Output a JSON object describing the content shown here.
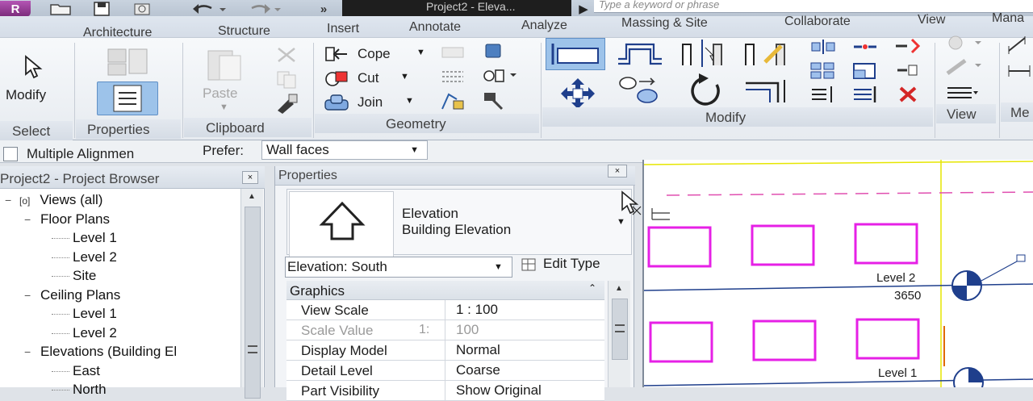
{
  "titlebar": {
    "title": "Project2 - Eleva...",
    "search_placeholder": "Type a keyword or phrase",
    "overflow": "»"
  },
  "tabs": [
    "Architecture",
    "Structure",
    "Insert",
    "Annotate",
    "Analyze",
    "Massing & Site",
    "Collaborate",
    "View",
    "Mana"
  ],
  "ribbon": {
    "select": {
      "modify_label": "Modify",
      "panel": "Select"
    },
    "properties": {
      "panel": "Properties"
    },
    "clipboard": {
      "paste_label": "Paste",
      "panel": "Clipboard"
    },
    "geometry": {
      "cope": "Cope",
      "cut": "Cut",
      "join": "Join",
      "panel": "Geometry"
    },
    "modify": {
      "panel": "Modify"
    },
    "view": {
      "panel": "View"
    },
    "measure": {
      "panel": "Me"
    }
  },
  "options_bar": {
    "multiple_alignment": "Multiple Alignmen",
    "prefer_label": "Prefer:",
    "prefer_value": "Wall faces"
  },
  "project_browser": {
    "title": "Project2 - Project Browser",
    "close": "×",
    "tree": [
      {
        "label": "Views (all)",
        "depth": 0,
        "expander": "−"
      },
      {
        "label": "Floor Plans",
        "depth": 1,
        "expander": "−"
      },
      {
        "label": "Level 1",
        "depth": 2,
        "expander": ""
      },
      {
        "label": "Level 2",
        "depth": 2,
        "expander": ""
      },
      {
        "label": "Site",
        "depth": 2,
        "expander": ""
      },
      {
        "label": "Ceiling Plans",
        "depth": 1,
        "expander": "−"
      },
      {
        "label": "Level 1",
        "depth": 2,
        "expander": ""
      },
      {
        "label": "Level 2",
        "depth": 2,
        "expander": ""
      },
      {
        "label": "Elevations (Building El",
        "depth": 1,
        "expander": "−"
      },
      {
        "label": "East",
        "depth": 2,
        "expander": ""
      },
      {
        "label": "North",
        "depth": 2,
        "expander": ""
      }
    ]
  },
  "properties": {
    "title": "Properties",
    "close": "×",
    "type_name": "Elevation",
    "type_sub": "Building Elevation",
    "selector": "Elevation: South",
    "edit_type": "Edit Type",
    "group": "Graphics",
    "rows": [
      {
        "label": "View Scale",
        "value": "1 : 100",
        "prefix": "",
        "disabled": false
      },
      {
        "label": "Scale Value",
        "value": "100",
        "prefix": "1:",
        "disabled": true
      },
      {
        "label": "Display Model",
        "value": "Normal",
        "prefix": "",
        "disabled": false
      },
      {
        "label": "Detail Level",
        "value": "Coarse",
        "prefix": "",
        "disabled": false
      },
      {
        "label": "Part Visibility",
        "value": "Show Original",
        "prefix": "",
        "disabled": false
      }
    ]
  },
  "drawing": {
    "level2_label": "Level 2",
    "level2_elev": "3650",
    "level1_label": "Level 1"
  },
  "colors": {
    "window": "#e620e6",
    "level_line": "#1f3f8c",
    "yellow": "#e6e600",
    "ref_plane": "#e04fb0",
    "accent_select": "#9dc3ea"
  }
}
